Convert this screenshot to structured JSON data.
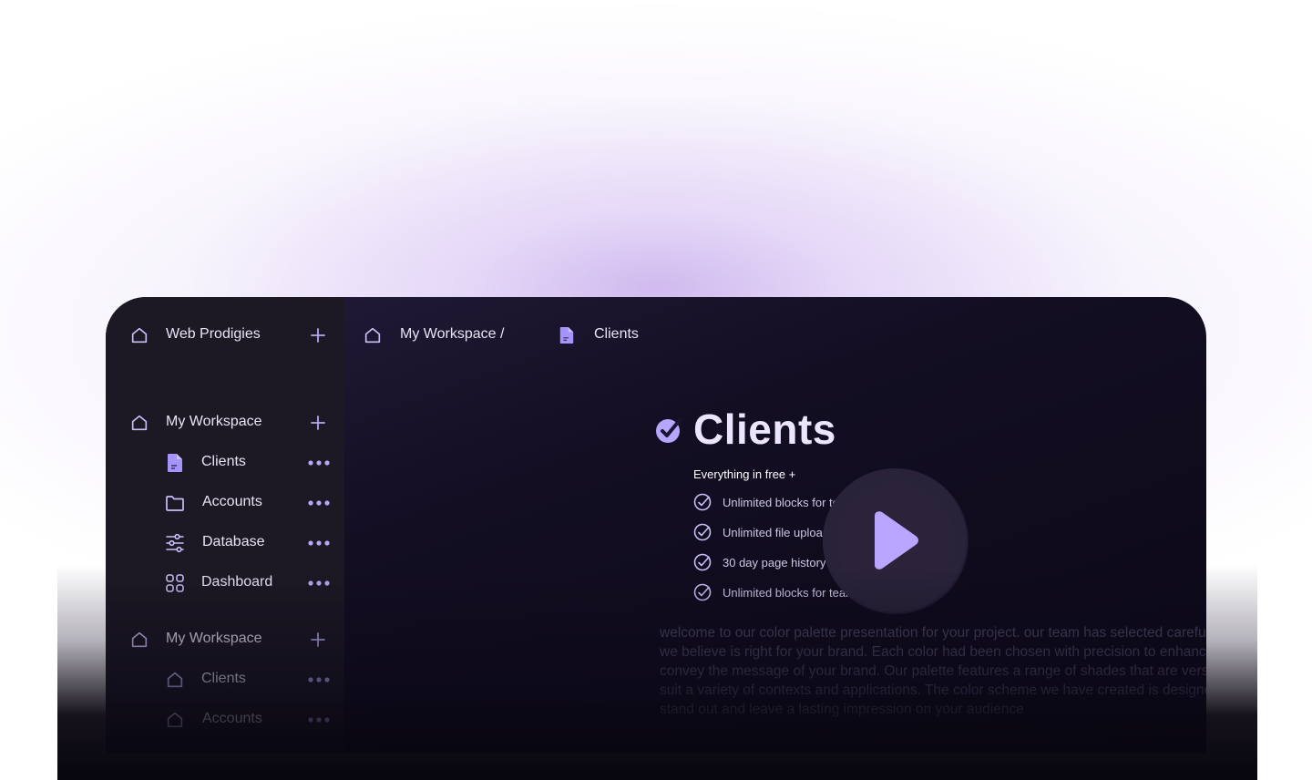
{
  "sidebar": {
    "team": {
      "label": "Web Prodigies"
    },
    "sections": [
      {
        "label": "My Workspace",
        "items": [
          {
            "label": "Clients",
            "icon": "file-icon"
          },
          {
            "label": "Accounts",
            "icon": "folder-icon"
          },
          {
            "label": "Database",
            "icon": "sliders-icon"
          },
          {
            "label": "Dashboard",
            "icon": "grid-icon"
          }
        ]
      },
      {
        "label": "My Workspace",
        "items": [
          {
            "label": "Clients",
            "icon": "home-icon"
          },
          {
            "label": "Accounts",
            "icon": "home-icon"
          }
        ]
      }
    ]
  },
  "breadcrumb": {
    "workspace": "My Workspace /",
    "page": "Clients"
  },
  "page": {
    "title": "Clients",
    "subtitle": "Everything in free +",
    "features": [
      "Unlimited blocks for teams",
      "Unlimited file uploads",
      "30 day page history",
      "Unlimited blocks for teams"
    ],
    "paragraph": "welcome to our color palette presentation for your project. our team has selected carefully a selection of colors that we believe is right for your brand. Each color had been chosen with precision to enhance the visual appeal and convey the message of your brand. Our palette features a range of shades that are versatile and can be adapted to suit a variety of contexts and applications. The color scheme we have created is designed to make your project stand out and leave a lasting impression on your audience"
  },
  "colors": {
    "accent": "#a594f9",
    "panel": "#1c1824",
    "background": "#130e22"
  }
}
